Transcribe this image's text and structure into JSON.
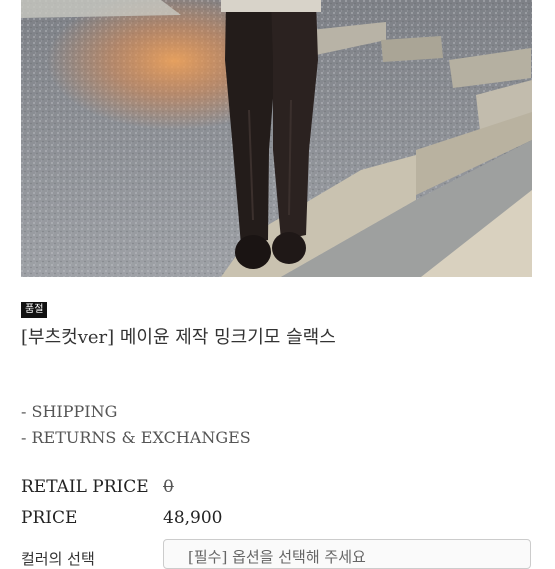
{
  "badge": "품절",
  "product_title": "[부츠컷ver] 메이윤 제작 밍크기모 슬랙스",
  "links": {
    "shipping": "- SHIPPING",
    "returns": "- RETURNS & EXCHANGES"
  },
  "retail_price": {
    "label": "RETAIL PRICE",
    "value": "0"
  },
  "price": {
    "label": "PRICE",
    "value": "48,900"
  },
  "option": {
    "label": "컬러의 선택",
    "select_value": "[필수] 옵션을 선택해 주세요"
  }
}
